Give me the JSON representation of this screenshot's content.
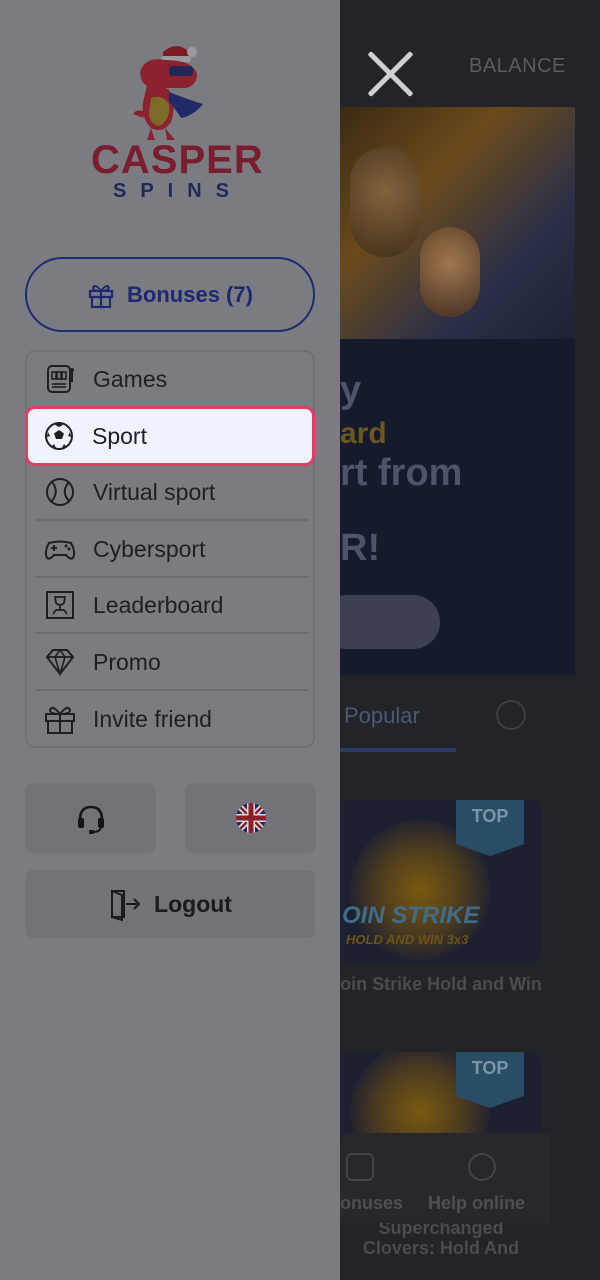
{
  "header": {
    "balance_label": "BALANCE"
  },
  "promo_banner": {
    "lines": [
      "y",
      "ard",
      "rt from",
      "R!"
    ]
  },
  "tabs": {
    "active_label": "Popular"
  },
  "games": [
    {
      "title_art": "OIN STRIKE",
      "subtitle_art": "HOLD AND WIN 3x3",
      "badge": "TOP",
      "name": "oin Strike Hold and Win"
    },
    {
      "badge": "TOP",
      "name": "Superchanged Clovers: Hold And"
    }
  ],
  "bottom_nav": {
    "bonuses_label": "onuses",
    "help_label": "Help online"
  },
  "drawer": {
    "logo_text_top": "CASPER",
    "logo_text_bottom": "SPINS",
    "bonuses_button": "Bonuses (7)",
    "menu": [
      {
        "label": "Games",
        "icon": "slot-machine-icon"
      },
      {
        "label": "Sport",
        "icon": "soccer-ball-icon",
        "active": true
      },
      {
        "label": "Virtual sport",
        "icon": "tennis-ball-icon"
      },
      {
        "label": "Cybersport",
        "icon": "gamepad-icon"
      },
      {
        "label": "Leaderboard",
        "icon": "leaderboard-icon"
      },
      {
        "label": "Promo",
        "icon": "diamond-icon"
      },
      {
        "label": "Invite friend",
        "icon": "gift-icon"
      }
    ],
    "support_icon": "headset-icon",
    "language_icon": "uk-flag-icon",
    "logout_button": "Logout"
  },
  "colors": {
    "active_border": "#e53c64",
    "active_background": "#eff3fd",
    "brand_blue": "#1d2870",
    "overlay_panel": "#7b7c81"
  }
}
